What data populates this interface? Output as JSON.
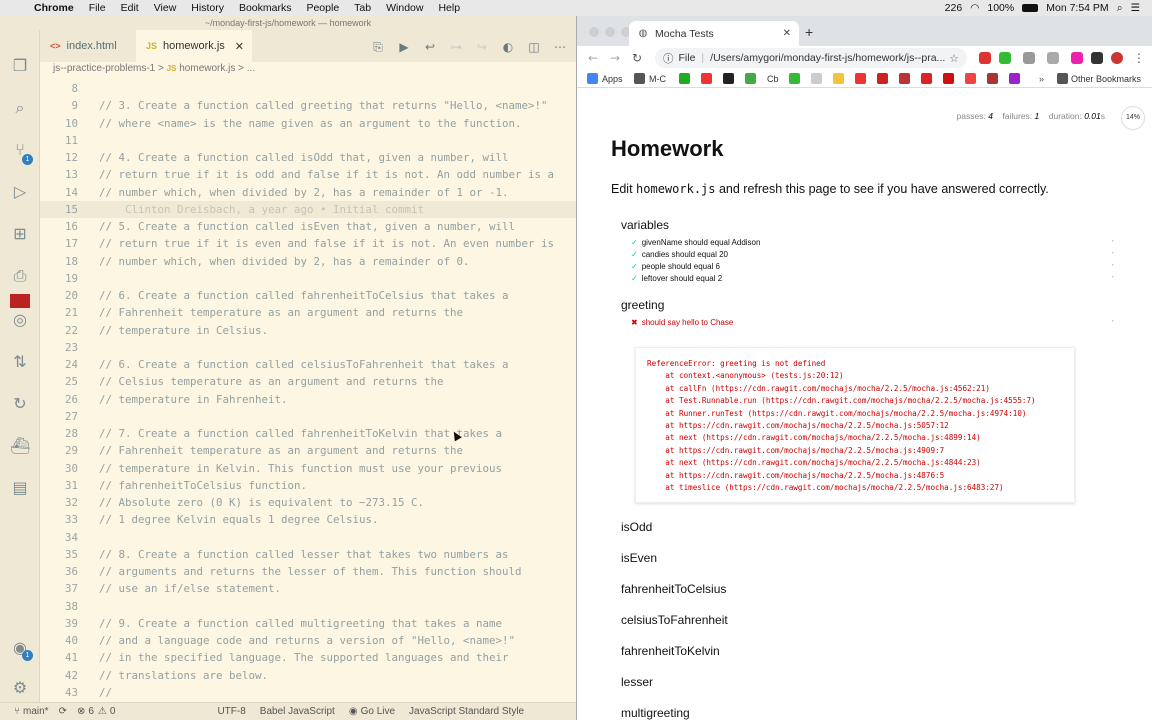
{
  "menubar": {
    "app_name": "Chrome",
    "items": [
      "File",
      "Edit",
      "View",
      "History",
      "Bookmarks",
      "People",
      "Tab",
      "Window",
      "Help"
    ],
    "battery": "100%",
    "clock": "Mon 7:54 PM",
    "tray_count": "226"
  },
  "vscode": {
    "title": "~/monday-first-js/homework — homework",
    "tabs": [
      {
        "label": "index.html",
        "icon": "html-file-icon"
      },
      {
        "label": "homework.js",
        "icon": "js-file-icon"
      }
    ],
    "breadcrumb": {
      "folder": "js--practice-problems-1",
      "sep": ">",
      "file_icon": "JS",
      "file": "homework.js",
      "more": "..."
    },
    "lines": [
      {
        "n": "8",
        "text": ""
      },
      {
        "n": "9",
        "text": "// 3. Create a function called greeting that returns \"Hello, <name>!\""
      },
      {
        "n": "10",
        "text": "// where <name> is the name given as an argument to the function."
      },
      {
        "n": "11",
        "text": ""
      },
      {
        "n": "12",
        "text": "// 4. Create a function called isOdd that, given a number, will"
      },
      {
        "n": "13",
        "text": "// return true if it is odd and false if it is not. An odd number is a"
      },
      {
        "n": "14",
        "text": "// number which, when divided by 2, has a remainder of 1 or -1."
      },
      {
        "n": "15",
        "text": "    Clinton Dreisbach, a year ago • Initial commit"
      },
      {
        "n": "16",
        "text": "// 5. Create a function called isEven that, given a number, will"
      },
      {
        "n": "17",
        "text": "// return true if it is even and false if it is not. An even number is"
      },
      {
        "n": "18",
        "text": "// number which, when divided by 2, has a remainder of 0."
      },
      {
        "n": "19",
        "text": ""
      },
      {
        "n": "20",
        "text": "// 6. Create a function called fahrenheitToCelsius that takes a"
      },
      {
        "n": "21",
        "text": "// Fahrenheit temperature as an argument and returns the"
      },
      {
        "n": "22",
        "text": "// temperature in Celsius."
      },
      {
        "n": "23",
        "text": ""
      },
      {
        "n": "24",
        "text": "// 6. Create a function called celsiusToFahrenheit that takes a"
      },
      {
        "n": "25",
        "text": "// Celsius temperature as an argument and returns the"
      },
      {
        "n": "26",
        "text": "// temperature in Fahrenheit."
      },
      {
        "n": "27",
        "text": ""
      },
      {
        "n": "28",
        "text": "// 7. Create a function called fahrenheitToKelvin that takes a"
      },
      {
        "n": "29",
        "text": "// Fahrenheit temperature as an argument and returns the"
      },
      {
        "n": "30",
        "text": "// temperature in Kelvin. This function must use your previous"
      },
      {
        "n": "31",
        "text": "// fahrenheitToCelsius function."
      },
      {
        "n": "32",
        "text": "// Absolute zero (0 K) is equivalent to −273.15 C."
      },
      {
        "n": "33",
        "text": "// 1 degree Kelvin equals 1 degree Celsius."
      },
      {
        "n": "34",
        "text": ""
      },
      {
        "n": "35",
        "text": "// 8. Create a function called lesser that takes two numbers as"
      },
      {
        "n": "36",
        "text": "// arguments and returns the lesser of them. This function should"
      },
      {
        "n": "37",
        "text": "// use an if/else statement."
      },
      {
        "n": "38",
        "text": ""
      },
      {
        "n": "39",
        "text": "// 9. Create a function called multigreeting that takes a name"
      },
      {
        "n": "40",
        "text": "// and a language code and returns a version of \"Hello, <name>!\""
      },
      {
        "n": "41",
        "text": "// in the specified language. The supported languages and their"
      },
      {
        "n": "42",
        "text": "// translations are below."
      },
      {
        "n": "43",
        "text": "//"
      }
    ],
    "status": {
      "branch": "main*",
      "errors": "6",
      "warnings": "0",
      "encoding": "UTF-8",
      "language": "Babel JavaScript",
      "go_live": "Go Live",
      "style": "JavaScript Standard Style"
    },
    "activity_badges": [
      "1",
      "1"
    ]
  },
  "chrome": {
    "tab_title": "Mocha Tests",
    "url_scheme": "File",
    "url": "/Users/amygori/monday-first-js/homework/js--pra...",
    "bookmarks": [
      "Apps",
      "M-C",
      "Cb",
      "Other Bookmarks"
    ]
  },
  "mocha": {
    "stats": {
      "passes_label": "passes:",
      "passes": "4",
      "failures_label": "failures:",
      "failures": "1",
      "duration_label": "duration:",
      "duration": "0.01",
      "duration_unit": "s"
    },
    "progress": "14%",
    "title": "Homework",
    "intro_before": "Edit ",
    "intro_code": "homework.js",
    "intro_after": " and refresh this page to see if you have answered correctly.",
    "suites": [
      {
        "title": "variables",
        "tests": [
          {
            "mark": "✓",
            "text": "givenName should equal Addison"
          },
          {
            "mark": "✓",
            "text": "candies should equal 20"
          },
          {
            "mark": "✓",
            "text": "people should equal 6"
          },
          {
            "mark": "✓",
            "text": "leftover should equal 2"
          }
        ]
      },
      {
        "title": "greeting",
        "tests": [
          {
            "mark": "✖",
            "text": "should say hello to Chase"
          }
        ]
      }
    ],
    "error_lines": [
      "ReferenceError: greeting is not defined",
      "    at context.<anonymous> (tests.js:20:12)",
      "    at callFn (https://cdn.rawgit.com/mochajs/mocha/2.2.5/mocha.js:4562:21)",
      "    at Test.Runnable.run (https://cdn.rawgit.com/mochajs/mocha/2.2.5/mocha.js:4555:7)",
      "    at Runner.runTest (https://cdn.rawgit.com/mochajs/mocha/2.2.5/mocha.js:4974:10)",
      "    at https://cdn.rawgit.com/mochajs/mocha/2.2.5/mocha.js:5057:12",
      "    at next (https://cdn.rawgit.com/mochajs/mocha/2.2.5/mocha.js:4899:14)",
      "    at https://cdn.rawgit.com/mochajs/mocha/2.2.5/mocha.js:4909:7",
      "    at next (https://cdn.rawgit.com/mochajs/mocha/2.2.5/mocha.js:4844:23)",
      "    at https://cdn.rawgit.com/mochajs/mocha/2.2.5/mocha.js:4876:5",
      "    at timeslice (https://cdn.rawgit.com/mochajs/mocha/2.2.5/mocha.js:6483:27)"
    ],
    "other_suites": [
      "isOdd",
      "isEven",
      "fahrenheitToCelsius",
      "celsiusToFahrenheit",
      "fahrenheitToKelvin",
      "lesser",
      "multigreeting"
    ]
  }
}
